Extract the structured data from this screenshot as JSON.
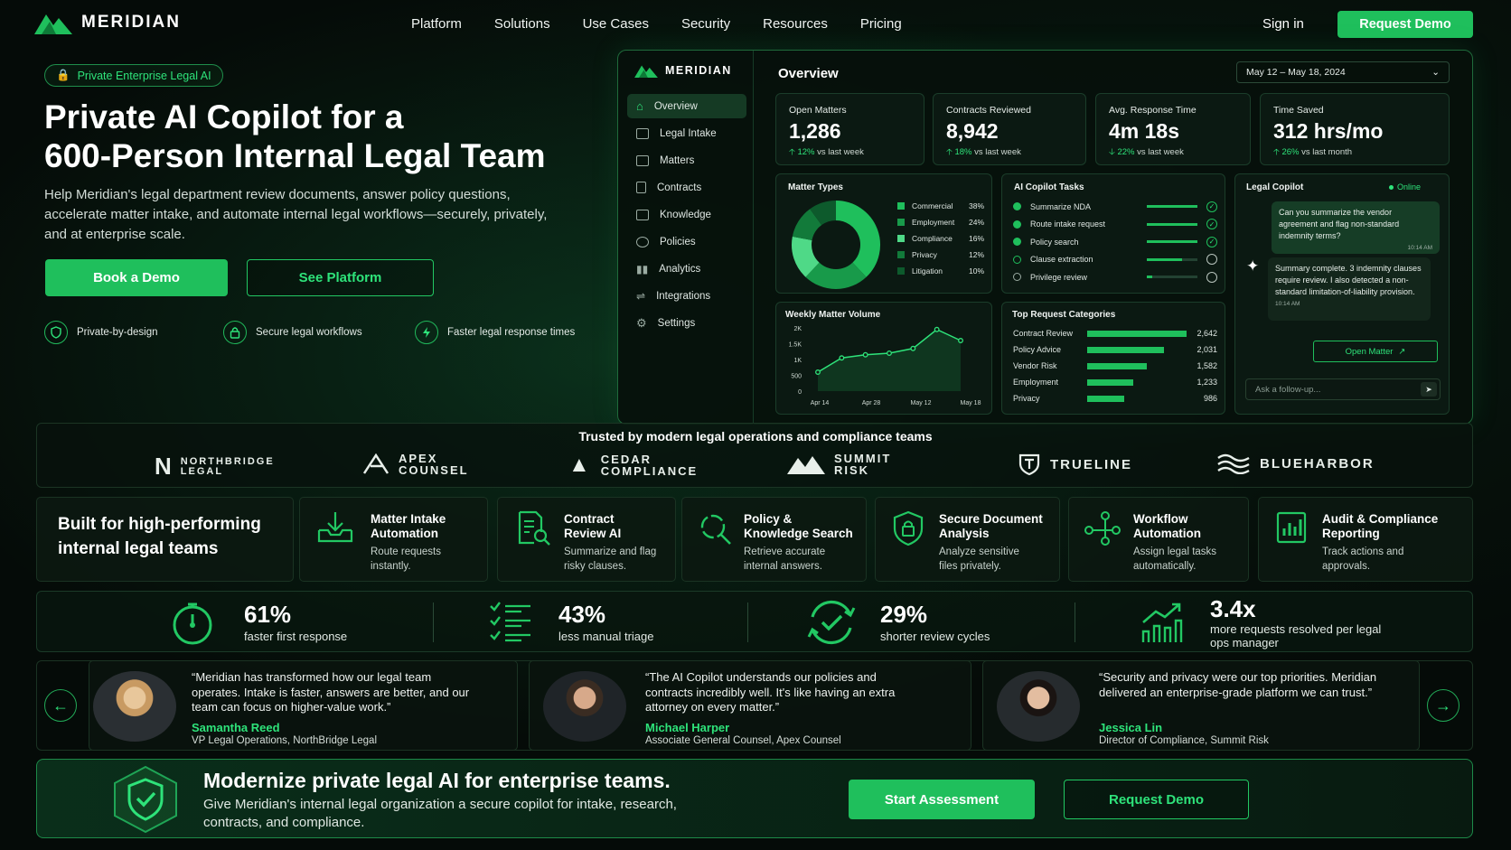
{
  "nav": {
    "brand": "MERIDIAN",
    "links": [
      "Platform",
      "Solutions",
      "Use Cases",
      "Security",
      "Resources",
      "Pricing"
    ],
    "signin": "Sign in",
    "cta": "Request Demo"
  },
  "hero": {
    "badge": "Private Enterprise Legal AI",
    "title_line1": "Private AI Copilot for a",
    "title_line2": "600-Person Internal Legal Team",
    "subtitle": "Help Meridian's legal department review documents, answer policy questions, accelerate matter intake, and automate internal legal workflows—securely, privately, and at enterprise scale.",
    "btn_primary": "Book a Demo",
    "btn_secondary": "See Platform",
    "features": [
      "Private-by-design",
      "Secure legal workflows",
      "Faster legal response times"
    ]
  },
  "dashboard": {
    "brand": "MERIDIAN",
    "title": "Overview",
    "date_range": "May 12 – May 18, 2024",
    "sidebar": [
      "Overview",
      "Legal Intake",
      "Matters",
      "Contracts",
      "Knowledge",
      "Policies",
      "Analytics",
      "Integrations",
      "Settings"
    ],
    "kpis": [
      {
        "label": "Open Matters",
        "value": "1,286",
        "change": "12%",
        "suffix": " vs last week",
        "dir": "up"
      },
      {
        "label": "Contracts Reviewed",
        "value": "8,942",
        "change": "18%",
        "suffix": " vs last week",
        "dir": "up"
      },
      {
        "label": "Avg. Response Time",
        "value": "4m 18s",
        "change": "22%",
        "suffix": " vs last week",
        "dir": "down"
      },
      {
        "label": "Time Saved",
        "value": "312 hrs/mo",
        "change": "26%",
        "suffix": " vs last month",
        "dir": "up"
      }
    ],
    "matter_types": {
      "title": "Matter Types",
      "items": [
        {
          "name": "Commercial",
          "pct": "38%",
          "value": 38,
          "color": "#1fbf5c"
        },
        {
          "name": "Employment",
          "pct": "24%",
          "value": 24,
          "color": "#189a4a"
        },
        {
          "name": "Compliance",
          "pct": "16%",
          "value": 16,
          "color": "#4fd987"
        },
        {
          "name": "Privacy",
          "pct": "12%",
          "value": 12,
          "color": "#127a3a"
        },
        {
          "name": "Litigation",
          "pct": "10%",
          "value": 10,
          "color": "#0d5a2c"
        }
      ]
    },
    "tasks": {
      "title": "AI Copilot Tasks",
      "items": [
        {
          "name": "Summarize NDA",
          "progress": 1.0,
          "done": true
        },
        {
          "name": "Route intake request",
          "progress": 1.0,
          "done": true
        },
        {
          "name": "Policy search",
          "progress": 1.0,
          "done": true
        },
        {
          "name": "Clause extraction",
          "progress": 0.7,
          "done": false
        },
        {
          "name": "Privilege review",
          "progress": 0.1,
          "done": false
        }
      ]
    },
    "weekly": {
      "title": "Weekly Matter Volume",
      "y_ticks": [
        "2K",
        "1.5K",
        "1K",
        "500",
        "0"
      ],
      "x_ticks": [
        "Apr 14",
        "Apr 28",
        "May 12",
        "May 18"
      ],
      "values": [
        600,
        1050,
        1150,
        1200,
        1350,
        1950,
        1600
      ],
      "ymax": 2000
    },
    "categories": {
      "title": "Top Request Categories",
      "items": [
        {
          "name": "Contract Review",
          "label": "2,642",
          "value": 2642
        },
        {
          "name": "Policy Advice",
          "label": "2,031",
          "value": 2031
        },
        {
          "name": "Vendor Risk",
          "label": "1,582",
          "value": 1582
        },
        {
          "name": "Employment",
          "label": "1,233",
          "value": 1233
        },
        {
          "name": "Privacy",
          "label": "986",
          "value": 986
        }
      ]
    },
    "copilot": {
      "title": "Legal Copilot",
      "status": "Online",
      "user_msg": "Can you summarize the vendor agreement and flag non-standard indemnity terms?",
      "user_time": "10:14 AM",
      "bot_msg": "Summary complete. 3 indemnity clauses require review. I also detected a non-standard limitation-of-liability provision.",
      "bot_time": "10:14 AM",
      "action": "Open Matter",
      "placeholder": "Ask a follow-up..."
    }
  },
  "trust": {
    "title": "Trusted by modern legal operations and compliance teams",
    "logos": [
      {
        "l1": "NORTHBRIDGE",
        "l2": "LEGAL"
      },
      {
        "l1": "APEX",
        "l2": "COUNSEL"
      },
      {
        "l1": "CEDAR",
        "l2": "COMPLIANCE"
      },
      {
        "l1": "SUMMIT",
        "l2": "RISK"
      },
      {
        "l1": "TRUELINE",
        "l2": ""
      },
      {
        "l1": "BLUEHARBOR",
        "l2": ""
      }
    ]
  },
  "features": {
    "heading": "Built for high-performing internal legal teams",
    "items": [
      {
        "t1": "Matter Intake",
        "t2": "Automation",
        "d1": "Route requests",
        "d2": "instantly."
      },
      {
        "t1": "Contract",
        "t2": "Review AI",
        "d1": "Summarize and flag",
        "d2": "risky clauses."
      },
      {
        "t1": "Policy &",
        "t2": "Knowledge Search",
        "d1": "Retrieve accurate",
        "d2": "internal answers."
      },
      {
        "t1": "Secure Document",
        "t2": "Analysis",
        "d1": "Analyze sensitive",
        "d2": "files privately."
      },
      {
        "t1": "Workflow",
        "t2": "Automation",
        "d1": "Assign legal tasks",
        "d2": "automatically."
      },
      {
        "t1": "Audit & Compliance",
        "t2": "Reporting",
        "d1": "Track actions and",
        "d2": "approvals."
      }
    ]
  },
  "stats": [
    {
      "value": "61%",
      "label": "faster first response"
    },
    {
      "value": "43%",
      "label": "less manual triage"
    },
    {
      "value": "29%",
      "label": "shorter review cycles"
    },
    {
      "value": "3.4x",
      "label": "more requests resolved per legal ops manager"
    }
  ],
  "testimonials": [
    {
      "quote": "“Meridian has transformed how our legal team operates. Intake is faster, answers are better, and our team can focus on higher-value work.”",
      "name": "Samantha Reed",
      "role": "VP Legal Operations, NorthBridge Legal"
    },
    {
      "quote": "“The AI Copilot understands our policies and contracts incredibly well. It's like having an extra attorney on every matter.”",
      "name": "Michael Harper",
      "role": "Associate General Counsel, Apex Counsel"
    },
    {
      "quote": "“Security and privacy were our top priorities. Meridian delivered an enterprise-grade platform we can trust.”",
      "name": "Jessica Lin",
      "role": "Director of Compliance, Summit Risk"
    }
  ],
  "cta": {
    "title": "Modernize private legal AI for enterprise teams.",
    "subtitle": "Give Meridian's internal legal organization a secure copilot for intake, research, contracts, and compliance.",
    "primary": "Start Assessment",
    "secondary": "Request Demo"
  }
}
